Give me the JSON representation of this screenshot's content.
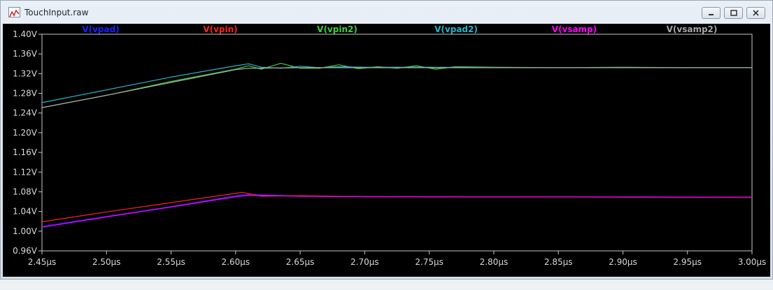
{
  "window": {
    "title": "TouchInput.raw",
    "icon": "waveform-icon",
    "controls": {
      "minimize": "minimize-icon",
      "maximize": "maximize-icon",
      "close": "close-icon"
    }
  },
  "chart_data": {
    "type": "line",
    "grid": false,
    "background": "#000000",
    "xlim": [
      2.45,
      3.0
    ],
    "ylim": [
      0.96,
      1.4
    ],
    "x_ticks": [
      "2.45µs",
      "2.50µs",
      "2.55µs",
      "2.60µs",
      "2.65µs",
      "2.70µs",
      "2.75µs",
      "2.80µs",
      "2.85µs",
      "2.90µs",
      "2.95µs",
      "3.00µs"
    ],
    "y_ticks": [
      "0.96V",
      "1.00V",
      "1.04V",
      "1.08V",
      "1.12V",
      "1.16V",
      "1.20V",
      "1.24V",
      "1.28V",
      "1.32V",
      "1.36V",
      "1.40V"
    ],
    "x_tick_values": [
      2.45,
      2.5,
      2.55,
      2.6,
      2.65,
      2.7,
      2.75,
      2.8,
      2.85,
      2.9,
      2.95,
      3.0
    ],
    "y_tick_values": [
      0.96,
      1.0,
      1.04,
      1.08,
      1.12,
      1.16,
      1.2,
      1.24,
      1.28,
      1.32,
      1.36,
      1.4
    ],
    "series": [
      {
        "name": "V(vpad)",
        "color": "#2020ff",
        "x": [
          2.45,
          2.5,
          2.55,
          2.6,
          2.61,
          2.62,
          2.65,
          2.7,
          3.0
        ],
        "y": [
          1.01,
          1.03,
          1.05,
          1.072,
          1.075,
          1.074,
          1.071,
          1.07,
          1.069
        ]
      },
      {
        "name": "V(vpin)",
        "color": "#ff2020",
        "x": [
          2.45,
          2.5,
          2.55,
          2.6,
          2.605,
          2.62,
          2.65,
          2.7,
          3.0
        ],
        "y": [
          1.019,
          1.039,
          1.058,
          1.077,
          1.079,
          1.071,
          1.072,
          1.07,
          1.069
        ]
      },
      {
        "name": "V(vpin2)",
        "color": "#3cd23c",
        "x": [
          2.45,
          2.5,
          2.55,
          2.6,
          2.61,
          2.62,
          2.635,
          2.65,
          2.665,
          2.68,
          2.695,
          2.71,
          2.725,
          2.74,
          2.755,
          2.77,
          2.8,
          2.85,
          2.9,
          2.95,
          3.0
        ],
        "y": [
          1.251,
          1.276,
          1.304,
          1.329,
          1.336,
          1.329,
          1.341,
          1.331,
          1.331,
          1.338,
          1.33,
          1.334,
          1.331,
          1.336,
          1.329,
          1.334,
          1.333,
          1.332,
          1.333,
          1.332,
          1.332
        ]
      },
      {
        "name": "V(vpad2)",
        "color": "#28b4c8",
        "x": [
          2.45,
          2.5,
          2.55,
          2.6,
          2.61,
          2.62,
          2.635,
          2.65,
          2.665,
          2.68,
          2.7,
          2.75,
          2.8,
          3.0
        ],
        "y": [
          1.261,
          1.287,
          1.313,
          1.336,
          1.34,
          1.333,
          1.331,
          1.335,
          1.332,
          1.334,
          1.333,
          1.333,
          1.332,
          1.332
        ]
      },
      {
        "name": "V(vsamp)",
        "color": "#ff00ff",
        "x": [
          2.45,
          2.5,
          2.55,
          2.6,
          2.61,
          2.65,
          2.7,
          3.0
        ],
        "y": [
          1.008,
          1.029,
          1.049,
          1.07,
          1.073,
          1.071,
          1.07,
          1.069
        ]
      },
      {
        "name": "V(vsamp2)",
        "color": "#a6a6a6",
        "x": [
          2.45,
          2.5,
          2.55,
          2.6,
          2.61,
          2.65,
          2.7,
          3.0
        ],
        "y": [
          1.251,
          1.276,
          1.302,
          1.328,
          1.331,
          1.332,
          1.332,
          1.332
        ]
      }
    ]
  }
}
